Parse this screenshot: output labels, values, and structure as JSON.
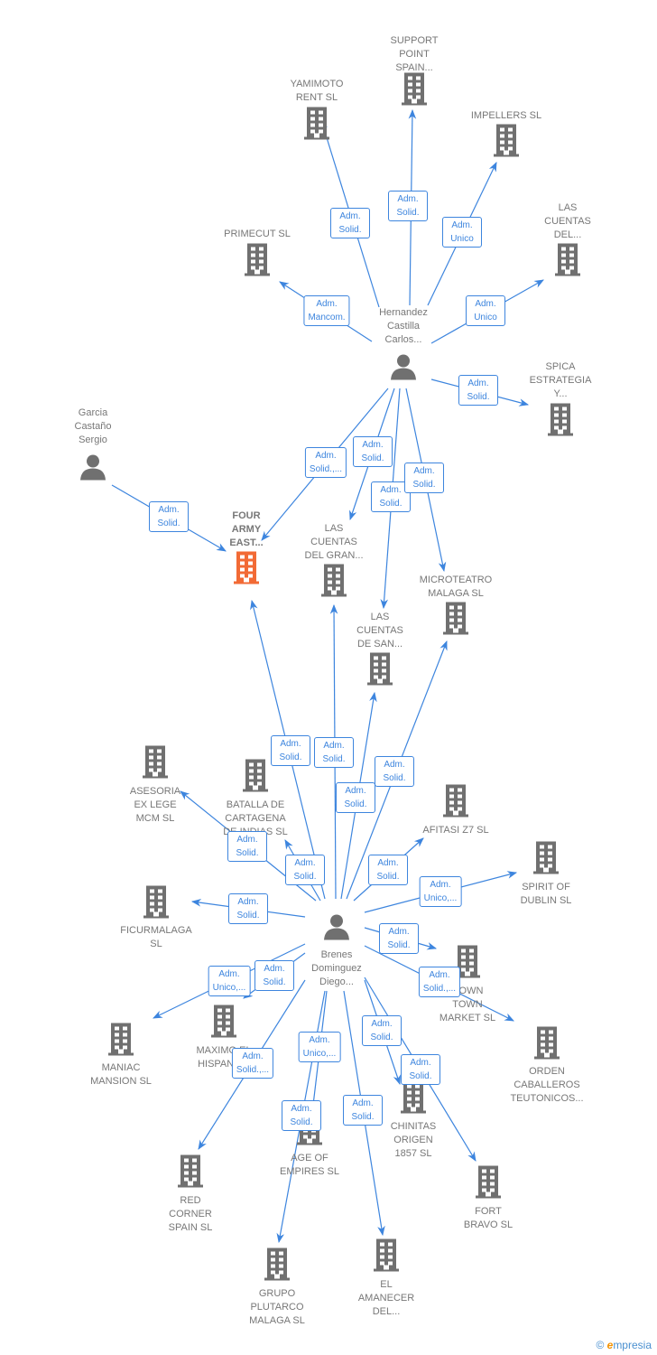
{
  "colors": {
    "edge": "#3d85de",
    "node": "#707070",
    "highlight": "#f26a35",
    "text": "#777777"
  },
  "nodes": [
    {
      "id": "support",
      "type": "company",
      "label": "SUPPORT\nPOINT\nSPAIN..."
    },
    {
      "id": "yamimoto",
      "type": "company",
      "label": "YAMIMOTO\nRENT  SL"
    },
    {
      "id": "impellers",
      "type": "company",
      "label": "IMPELLERS SL"
    },
    {
      "id": "primecut",
      "type": "company",
      "label": "PRIMECUT  SL"
    },
    {
      "id": "cuentasdel",
      "type": "company",
      "label": "LAS\nCUENTAS\nDEL..."
    },
    {
      "id": "hernandez",
      "type": "person",
      "label": "Hernandez\nCastilla\nCarlos..."
    },
    {
      "id": "spica",
      "type": "company",
      "label": "SPICA\nESTRATEGIA\nY..."
    },
    {
      "id": "garcia",
      "type": "person",
      "label": "Garcia\nCastaño\nSergio"
    },
    {
      "id": "four",
      "type": "company",
      "highlight": true,
      "label": "FOUR\nARMY\nEAST..."
    },
    {
      "id": "cuentasgran",
      "type": "company",
      "label": "LAS\nCUENTAS\nDEL GRAN..."
    },
    {
      "id": "microteatro",
      "type": "company",
      "label": "MICROTEATRO\nMALAGA  SL"
    },
    {
      "id": "cuentassan",
      "type": "company",
      "label": "LAS\nCUENTAS\nDE SAN..."
    },
    {
      "id": "asesoria",
      "type": "company",
      "label": "ASESORIA\nEX LEGE\nMCM  SL"
    },
    {
      "id": "batalla",
      "type": "company",
      "label": "BATALLA DE\nCARTAGENA\nDE INDIAS  SL"
    },
    {
      "id": "afitasi",
      "type": "company",
      "label": "AFITASI Z7  SL"
    },
    {
      "id": "spirit",
      "type": "company",
      "label": "SPIRIT OF\nDUBLIN  SL"
    },
    {
      "id": "ficurmalaga",
      "type": "company",
      "label": "FICURMALAGA\nSL"
    },
    {
      "id": "brenes",
      "type": "person",
      "label": "Brenes\nDominguez\nDiego..."
    },
    {
      "id": "downtown",
      "type": "company",
      "label": "DOWN\nTOWN\nMARKET  SL"
    },
    {
      "id": "maniac",
      "type": "company",
      "label": "MANIAC\nMANSION  SL"
    },
    {
      "id": "maximo",
      "type": "company",
      "label": "MAXIMO EL\nHISPANO..."
    },
    {
      "id": "orden",
      "type": "company",
      "label": "ORDEN\nCABALLEROS\nTEUTONICOS..."
    },
    {
      "id": "chinitas",
      "type": "company",
      "label": "CHINITAS\nORIGEN\n1857  SL"
    },
    {
      "id": "ageofempires",
      "type": "company",
      "label": "AGE OF\nEMPIRES  SL"
    },
    {
      "id": "redcorner",
      "type": "company",
      "label": "RED\nCORNER\nSPAIN  SL"
    },
    {
      "id": "fortbravo",
      "type": "company",
      "label": "FORT\nBRAVO  SL"
    },
    {
      "id": "grupo",
      "type": "company",
      "label": "GRUPO\nPLUTARCO\nMALAGA  SL"
    },
    {
      "id": "amanecer",
      "type": "company",
      "label": "EL\nAMANECER\nDEL..."
    }
  ],
  "edges": [
    {
      "from": "hernandez",
      "to": "support",
      "role": "Adm.\nSolid."
    },
    {
      "from": "hernandez",
      "to": "yamimoto",
      "role": "Adm.\nSolid."
    },
    {
      "from": "hernandez",
      "to": "impellers",
      "role": "Adm.\nUnico"
    },
    {
      "from": "hernandez",
      "to": "primecut",
      "role": "Adm.\nMancom."
    },
    {
      "from": "hernandez",
      "to": "cuentasdel",
      "role": "Adm.\nUnico"
    },
    {
      "from": "hernandez",
      "to": "spica",
      "role": "Adm.\nSolid."
    },
    {
      "from": "hernandez",
      "to": "four",
      "role": "Adm.\nSolid.,..."
    },
    {
      "from": "hernandez",
      "to": "cuentasgran",
      "role": "Adm.\nSolid."
    },
    {
      "from": "hernandez",
      "to": "cuentassan",
      "role": "Adm.\nSolid."
    },
    {
      "from": "hernandez",
      "to": "microteatro",
      "role": "Adm.\nSolid."
    },
    {
      "from": "garcia",
      "to": "four",
      "role": "Adm.\nSolid."
    },
    {
      "from": "brenes",
      "to": "four",
      "role": "Adm.\nSolid."
    },
    {
      "from": "brenes",
      "to": "cuentasgran",
      "role": "Adm.\nSolid."
    },
    {
      "from": "brenes",
      "to": "cuentassan",
      "role": "Adm.\nSolid."
    },
    {
      "from": "brenes",
      "to": "microteatro",
      "role": "Adm.\nSolid."
    },
    {
      "from": "brenes",
      "to": "asesoria",
      "role": "Adm.\nSolid."
    },
    {
      "from": "brenes",
      "to": "batalla",
      "role": "Adm.\nSolid."
    },
    {
      "from": "brenes",
      "to": "afitasi",
      "role": "Adm.\nSolid."
    },
    {
      "from": "brenes",
      "to": "spirit",
      "role": "Adm.\nUnico,..."
    },
    {
      "from": "brenes",
      "to": "ficurmalaga",
      "role": "Adm.\nSolid."
    },
    {
      "from": "brenes",
      "to": "downtown",
      "role": "Adm.\nSolid."
    },
    {
      "from": "brenes",
      "to": "orden",
      "role": "Adm.\nSolid.,..."
    },
    {
      "from": "brenes",
      "to": "maximo",
      "role": "Adm.\nSolid."
    },
    {
      "from": "brenes",
      "to": "maniac",
      "role": "Adm.\nUnico,..."
    },
    {
      "from": "brenes",
      "to": "redcorner",
      "role": "Adm.\nSolid.,..."
    },
    {
      "from": "brenes",
      "to": "ageofempires",
      "role": "Adm.\nUnico,..."
    },
    {
      "from": "brenes",
      "to": "grupo",
      "role": "Adm.\nSolid."
    },
    {
      "from": "brenes",
      "to": "chinitas",
      "role": "Adm.\nSolid."
    },
    {
      "from": "brenes",
      "to": "fortbravo",
      "role": "Adm.\nSolid."
    },
    {
      "from": "brenes",
      "to": "amanecer",
      "role": "Adm.\nSolid."
    }
  ],
  "footer": {
    "copyright": "©",
    "brand_initial": "e",
    "brand_rest": "mpresia"
  }
}
